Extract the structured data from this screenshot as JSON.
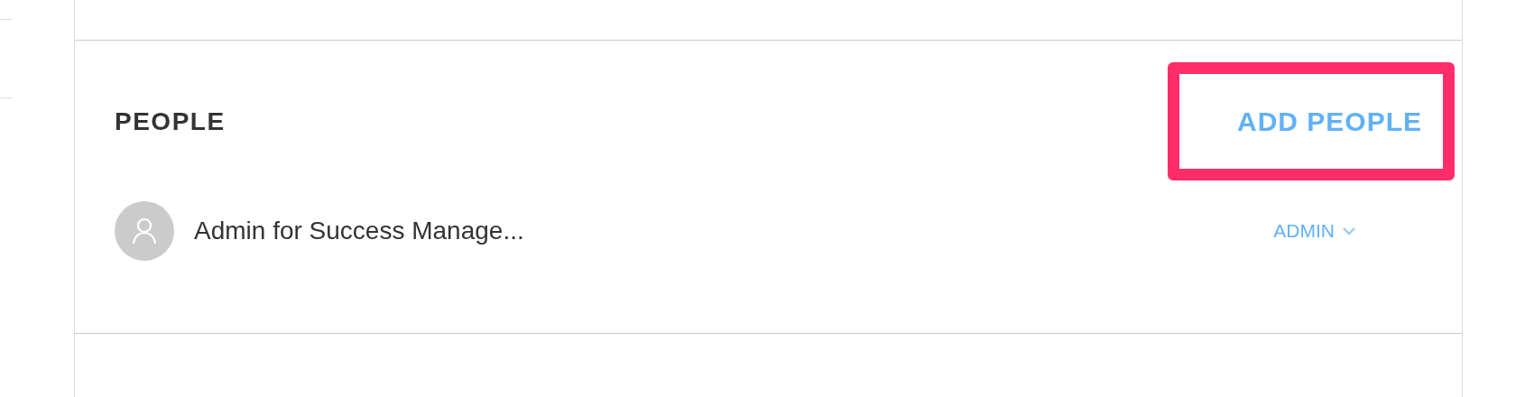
{
  "section": {
    "title": "PEOPLE",
    "add_button": {
      "label": "ADD PEOPLE",
      "highlighted": true
    },
    "people": [
      {
        "name": "Admin for Success Manage...",
        "role": "ADMIN"
      }
    ]
  }
}
